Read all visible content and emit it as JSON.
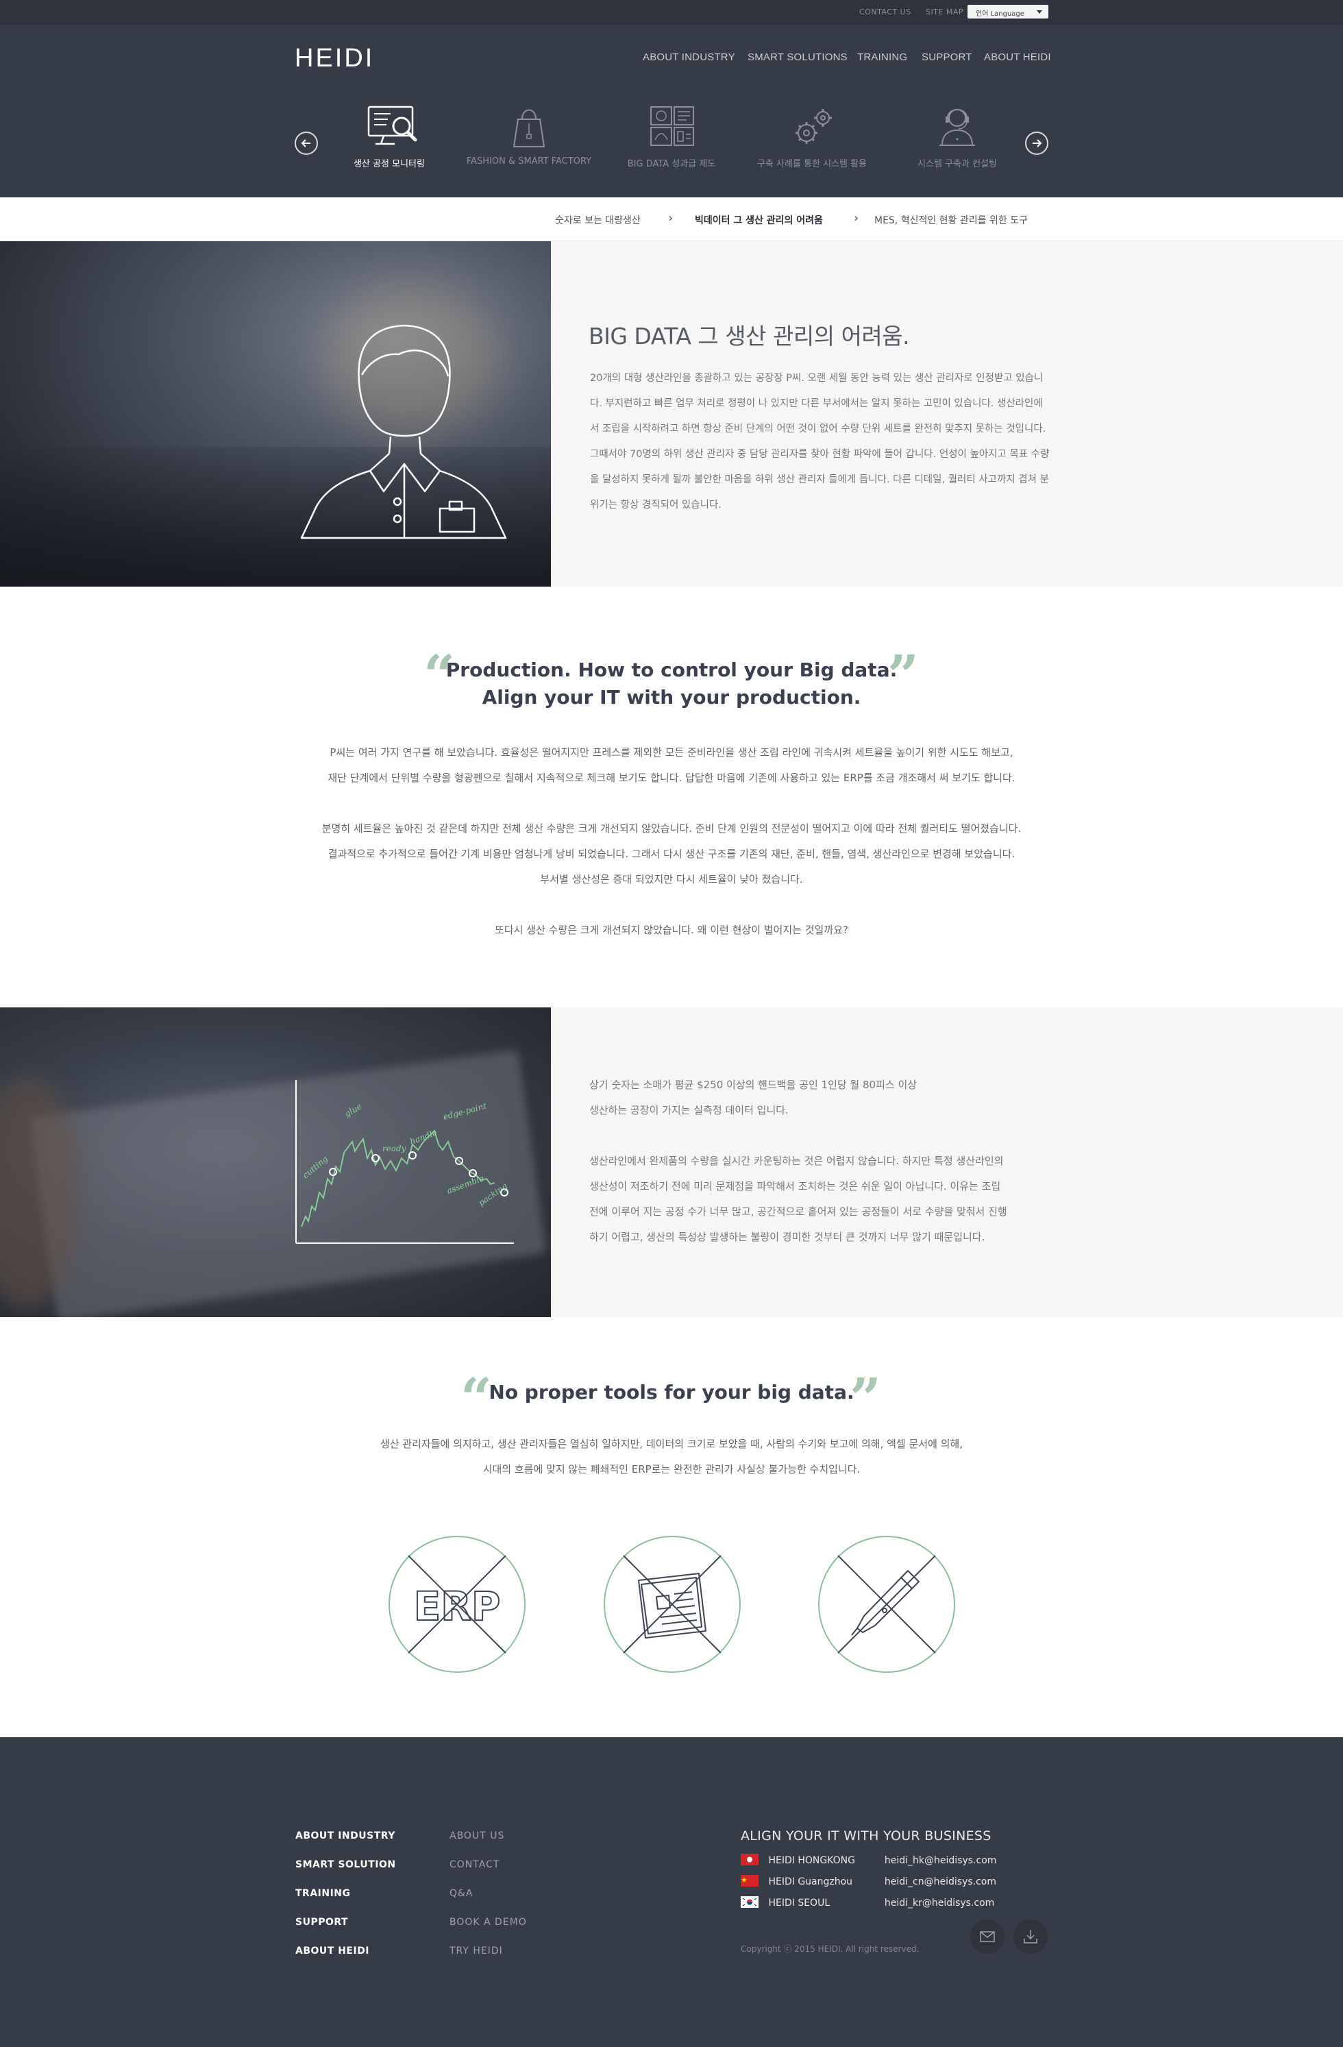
{
  "utility": {
    "contact_us": "CONTACT US",
    "site_map": "SITE MAP",
    "language": "언어 Language"
  },
  "header": {
    "logo": "HEIDI",
    "nav": [
      "ABOUT INDUSTRY",
      "SMART SOLUTIONS",
      "TRAINING",
      "SUPPORT",
      "ABOUT HEIDI"
    ],
    "prev_icon": "arrow-left-icon",
    "next_icon": "arrow-right-icon",
    "categories": [
      {
        "label": "생산 공정 모니터링",
        "icon": "monitor-magnifier-icon",
        "active": true
      },
      {
        "label": "FASHION & SMART FACTORY",
        "icon": "shopping-bag-icon",
        "active": false
      },
      {
        "label": "BIG DATA 성과급 제도",
        "icon": "dashboard-icon",
        "active": false
      },
      {
        "label": "구축 사례를 통한 시스템 활용",
        "icon": "gears-icon",
        "active": false
      },
      {
        "label": "시스템 구축과 컨설팅",
        "icon": "support-agent-icon",
        "active": false
      }
    ]
  },
  "breadcrumb": {
    "items": [
      "숫자로 보는 대량생산",
      "빅데이터 그 생산 관리의 어려움",
      "MES, 혁신적인 현황 관리를 위한 도구"
    ],
    "current_index": 1
  },
  "section1": {
    "title": "BIG DATA 그 생산 관리의 어려움.",
    "body": "20개의 대형 생산라인을 총괄하고 있는 공장장 P씨. 오랜 세월 동안 능력 있는 생산 관리자로 인정받고 있습니다. 부지런하고 빠른 업무 처리로 정평이 나 있지만 다른 부서에서는 알지 못하는 고민이 있습니다. 생산라인에서 조립을 시작하려고 하면 항상 준비 단계의 어떤 것이 없어 수량 단위 세트를 완전히 맞추지 못하는 것입니다. 그때서야 70명의 하위 생산 관리자 중 담당 관리자를 찾아 현황 파악에 들어 갑니다. 언성이 높아지고 목표 수량을 달성하지 못하게 될까 불안한 마음을 하위 생산 관리자 들에게 듭니다.  다른 디테일, 퀄러티 사고까지 겹쳐 분위기는 항상 경직되어 있습니다."
  },
  "quote1": {
    "title_line1": "Production. How to control your Big data.",
    "title_line2": "Align your IT with your production.",
    "paragraphs": [
      "P씨는 여러 가지 연구를 해 보았습니다. 효율성은 떨어지지만 프레스를 제외한 모든 준비라인을 생산 조립 라인에  귀속시켜 세트율을 높이기 위한 시도도 해보고,",
      "재단 단계에서 단위별 수량을 형광펜으로 칠해서 지속적으로 체크해 보기도 합니다. 답답한 마음에 기존에 사용하고 있는 ERP를 조금 개조해서 써 보기도 합니다.",
      "분명히 세트율은 높아진 것 같은데 하지만 전체 생산 수량은 크게 개선되지 않았습니다. 준비 단계 인원의 전문성이 떨어지고 이에 따라 전체 퀄러티도 떨어졌습니다.",
      "결과적으로 추가적으로 들어간 기계 비용만 엄청나게 낭비 되었습니다. 그래서 다시 생산 구조를 기존의 재단, 준비, 핸들, 염색, 생산라인으로 변경해 보았습니다.",
      "부서별 생산성은 증대 되었지만 다시 세트율이 낮아 졌습니다.",
      "또다시 생산 수량은 크게 개선되지 않았습니다.  왜 이런 현상이 벌어지는 것일까요?"
    ]
  },
  "section2": {
    "chart_labels": [
      "cutting",
      "glue",
      "ready",
      "handle",
      "edge-paint",
      "assemble",
      "packing"
    ],
    "body1_lines": [
      "상기 숫자는 소매가 평균 $250 이상의 핸드백을 공인 1인당 월 80피스 이상",
      "생산하는 공장이 가지는 실측정 데이터 입니다."
    ],
    "body2_lines": [
      "생산라인에서 완제품의 수량을 실시간 카운팅하는 것은 어렵지 않습니다.  하지만 특정 생산라인의",
      "생산성이 저조하기 전에 미리 문제점을 파악해서 조치하는 것은 쉬운 일이 아닙니다.  이유는 조립",
      "전에 이루어 지는 공정 수가 너무 많고, 공간적으로 흩어져 있는 공정들이 서로 수량을 맞춰서 진행",
      "하기 어렵고, 생산의 특성상 발생하는 불량이 경미한 것부터 큰 것까지 너무 많기 때문입니다."
    ]
  },
  "quote2": {
    "title": "No proper tools for your big data.",
    "paragraphs": [
      "생산 관리자들에 의지하고, 생산 관리자들은 열심히 일하지만, 데이터의 크기로 보았을 때, 사람의 수기와 보고에 의해, 엑셀 문서에 의해,",
      "시대의 흐름에 맞지 않는 폐쇄적인 ERP로는 완전한 관리가 사실상 불가능한 수치입니다."
    ],
    "icons": [
      {
        "name": "no-erp-icon",
        "text": "ERP"
      },
      {
        "name": "no-spreadsheet-icon",
        "text": ""
      },
      {
        "name": "no-pen-icon",
        "text": ""
      }
    ],
    "accent_color": "#8bbf99"
  },
  "footer": {
    "col1": [
      "ABOUT INDUSTRY",
      "SMART SOLUTION",
      "TRAINING",
      "SUPPORT",
      "ABOUT HEIDI"
    ],
    "col2": [
      "ABOUT US",
      "CONTACT",
      "Q&A",
      "BOOK A DEMO",
      "TRY HEIDI"
    ],
    "heading": "ALIGN YOUR IT WITH YOUR BUSINESS",
    "offices": [
      {
        "name": "HEIDI  HONGKONG",
        "email": "heidi_hk@heidisys.com",
        "flag": "hongkong-flag-icon"
      },
      {
        "name": "HEIDI  Guangzhou",
        "email": "heidi_cn@heidisys.com",
        "flag": "china-flag-icon"
      },
      {
        "name": "HEIDI  SEOUL",
        "email": "heidi_kr@heidisys.com",
        "flag": "korea-flag-icon"
      }
    ],
    "copyright": "Copyright ⓒ 2015 HEIDI.  All right reserved.",
    "icons": [
      "mail-icon",
      "download-icon"
    ]
  },
  "colors": {
    "header_bg": "#363c47",
    "utility_bg": "#2e333d",
    "panel_bg": "#f6f6f6",
    "quote_green": "#a7c7b0",
    "footer_bg": "#363c47"
  }
}
